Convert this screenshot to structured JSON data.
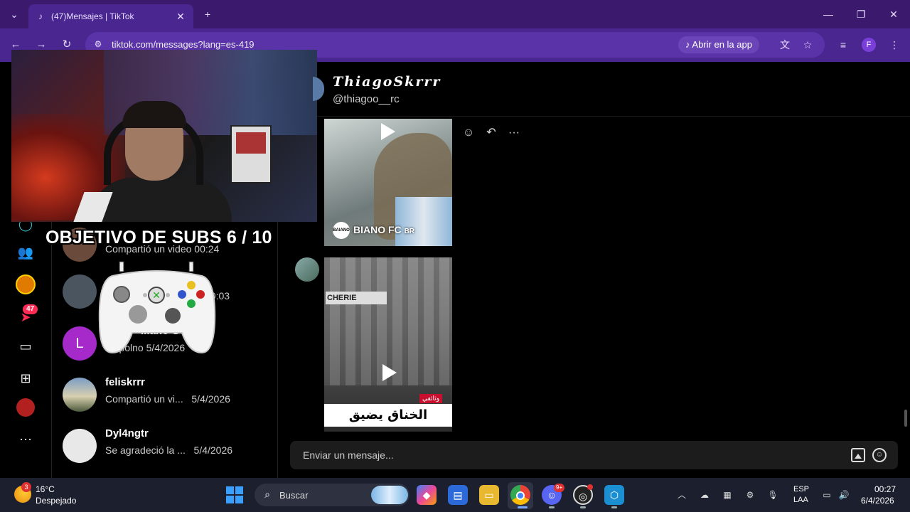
{
  "browser": {
    "tab_count_title": "(47)Mensajes | TikTok",
    "url": "tiktok.com/messages?lang=es-419",
    "open_app_label": "Abrir en la app",
    "profile_initial": "F"
  },
  "sidebar": {
    "notifications_badge": "47"
  },
  "overlay": {
    "subs_goal": "OBJETIVO DE SUBS 6 / 10"
  },
  "conversations": [
    {
      "name": "",
      "preview": "Compartió un video",
      "time": "00:24"
    },
    {
      "name": "",
      "preview": "",
      "time": "00:03"
    },
    {
      "avatar_letter": "L",
      "name": "...ano Gonz...",
      "preview": "no polno",
      "time": "5/4/2026"
    },
    {
      "name": "feliskrrr",
      "preview": "Compartió un vi...",
      "time": "5/4/2026"
    },
    {
      "name": "Dyl4ngtr",
      "preview": "Se agradeció la ...",
      "time": "5/4/2026"
    }
  ],
  "chat": {
    "display_name": "𝑻𝒉𝒊𝒂𝒈𝒐𝑺𝒌𝒓𝒓𝒓",
    "handle": "@thiagoo__rc",
    "video1_brand": "BIANO FC",
    "video1_brand_suffix": "BR",
    "video1_logo": "BAIANO",
    "video2_sign": "CHERIE",
    "video2_tag": "وثائقي",
    "video2_caption": "الخناق يضيق",
    "input_placeholder": "Enviar un mensaje..."
  },
  "taskbar": {
    "weather_badge": "3",
    "temperature": "16°C",
    "weather": "Despejado",
    "search_label": "Buscar",
    "discord_badge": "9+",
    "lang_line1": "ESP",
    "lang_line2": "LAA",
    "time": "00:27",
    "date": "6/4/2026"
  }
}
